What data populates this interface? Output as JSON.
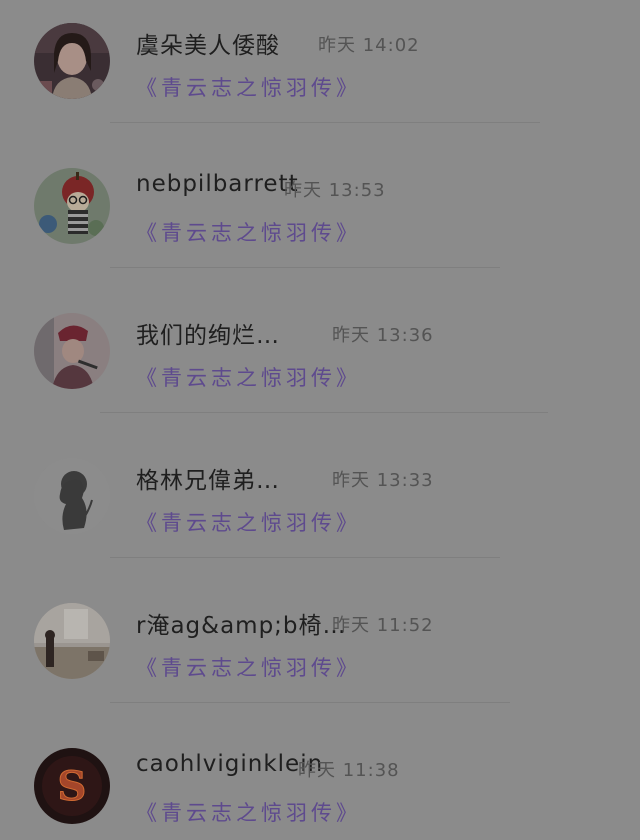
{
  "comments": [
    {
      "name": "虞朵美人倭酸",
      "time": "昨天 14:02",
      "subtitle": "《青云志之惊羽传》",
      "avatar_icon": "girl-portrait-avatar"
    },
    {
      "name": "nebpilbarrett",
      "time": "昨天 13:53",
      "subtitle": "《青云志之惊羽传》",
      "avatar_icon": "apple-head-toy-avatar"
    },
    {
      "name": "我们的绚烂…",
      "time": "昨天 13:36",
      "subtitle": "《青云志之惊羽传》",
      "avatar_icon": "person-with-hat-avatar"
    },
    {
      "name": "格林兄偉弟…",
      "time": "昨天 13:33",
      "subtitle": "《青云志之惊羽传》",
      "avatar_icon": "silhouette-avatar"
    },
    {
      "name": "r淹ag&amp;b椅…",
      "time": "昨天 11:52",
      "subtitle": "《青云志之惊羽传》",
      "avatar_icon": "room-interior-avatar"
    },
    {
      "name": "caohlviginklein",
      "time": "昨天 11:38",
      "subtitle": "《青云志之惊羽传》",
      "avatar_icon": "fire-letter-s-avatar"
    }
  ],
  "colors": {
    "overlay_background": "#8b8b8b",
    "name_text": "#1f1f1f",
    "time_text": "#545454",
    "subtitle_text": "#5e4a8e"
  }
}
